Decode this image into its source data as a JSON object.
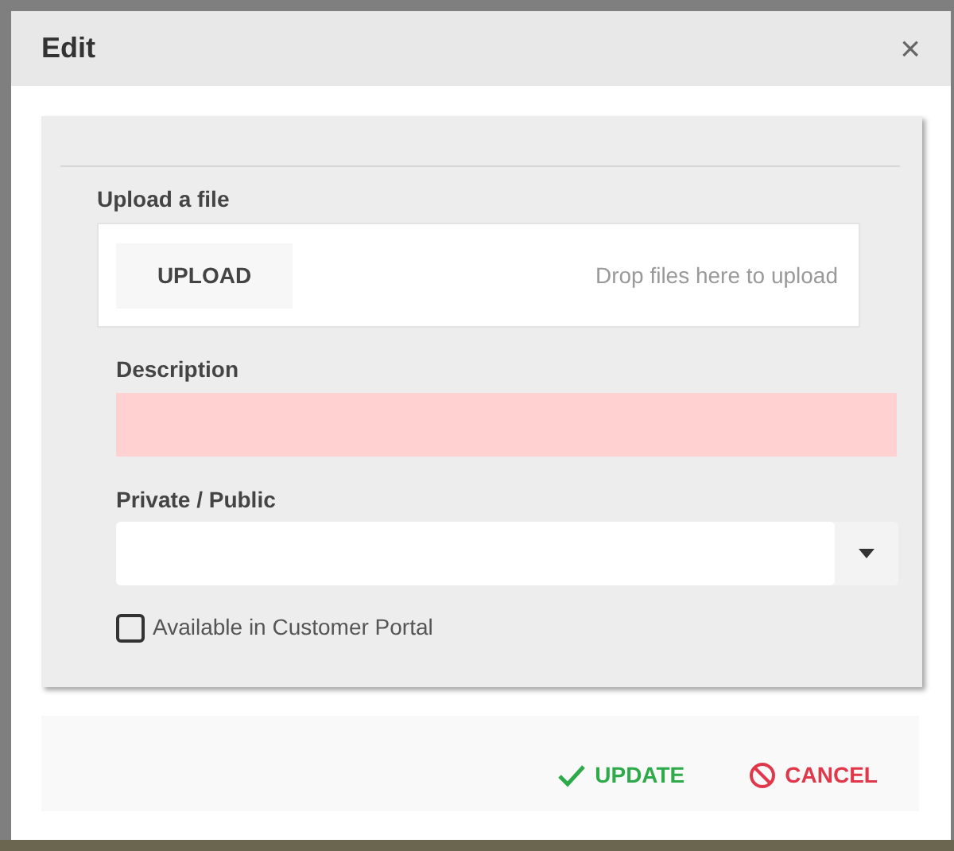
{
  "dialog": {
    "title": "Edit",
    "close": "×"
  },
  "upload": {
    "label": "Upload a file",
    "button": "UPLOAD",
    "hint": "Drop files here to upload"
  },
  "description": {
    "label": "Description",
    "invalid": true
  },
  "privacy": {
    "label": "Private / Public"
  },
  "portal": {
    "label": "Available in Customer Portal",
    "checked": false
  },
  "actions": [
    {
      "kind": "confirm",
      "label": "UPDATE"
    },
    {
      "kind": "cancel",
      "label": "CANCEL"
    }
  ]
}
